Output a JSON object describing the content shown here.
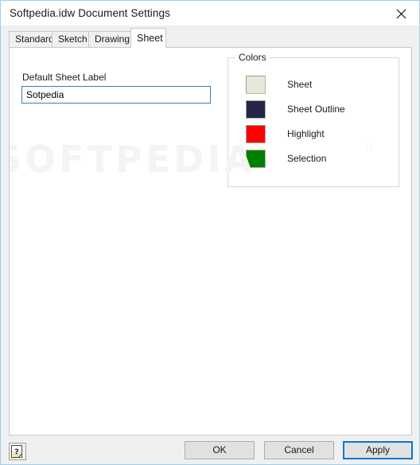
{
  "window": {
    "title": "Softpedia.idw Document Settings",
    "close_icon": "close-icon"
  },
  "tabs": [
    {
      "label": "Standard",
      "selected": false
    },
    {
      "label": "Sketch",
      "selected": false
    },
    {
      "label": "Drawing",
      "selected": false
    },
    {
      "label": "Sheet",
      "selected": true
    }
  ],
  "sheet_tab": {
    "default_sheet_label": {
      "label": "Default Sheet Label",
      "value": "Sotpedia",
      "placeholder": ""
    },
    "colors_group": {
      "title": "Colors",
      "items": [
        {
          "name": "Sheet",
          "color": "#e8e8d8"
        },
        {
          "name": "Sheet Outline",
          "color": "#252548"
        },
        {
          "name": "Highlight",
          "color": "#fe0000"
        },
        {
          "name": "Selection",
          "color": "#008000"
        }
      ]
    }
  },
  "watermark": {
    "text": "SOFTPEDIA"
  },
  "footer": {
    "help_label": "?",
    "buttons": [
      {
        "label": "OK",
        "default": false
      },
      {
        "label": "Cancel",
        "default": false
      },
      {
        "label": "Apply",
        "default": true
      }
    ]
  },
  "theme": {
    "accent": "#0078d7",
    "input_border": "#3c7fb1",
    "window_bg": "#f0f0f0"
  }
}
